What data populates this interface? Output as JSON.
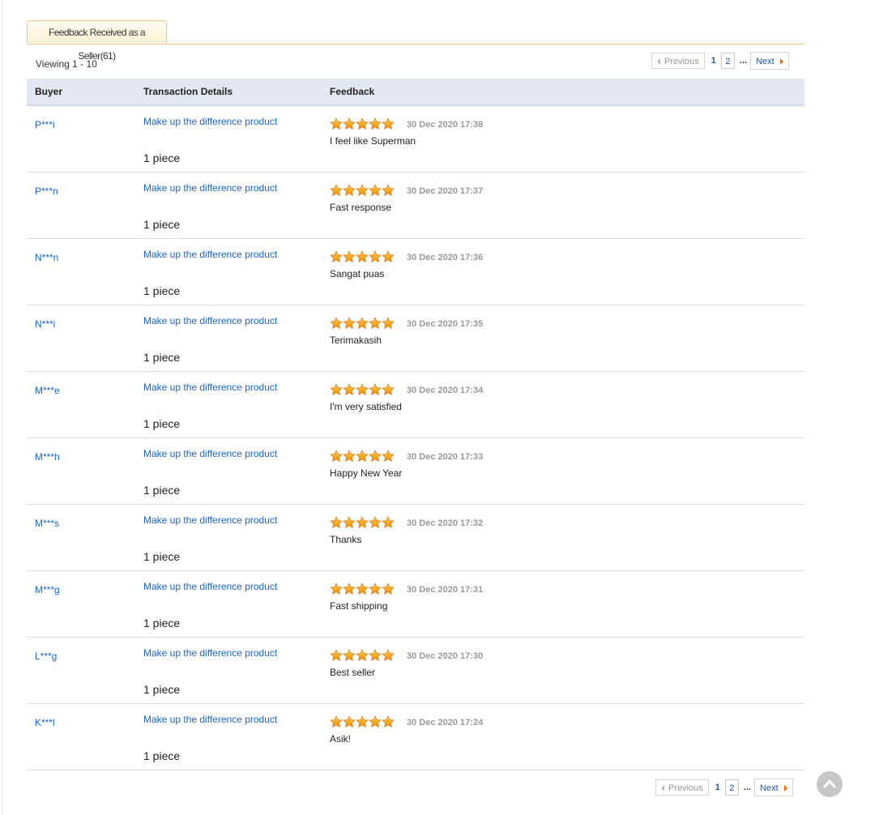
{
  "tab": {
    "label": "Feedback Received as a Seller(61)"
  },
  "viewing": "Viewing 1 - 10",
  "pager": {
    "prev": "Previous",
    "current": "1",
    "page2": "2",
    "dots": "...",
    "next": "Next"
  },
  "columns": {
    "buyer": "Buyer",
    "transaction": "Transaction Details",
    "feedback": "Feedback"
  },
  "rows": [
    {
      "buyer": "P***i",
      "product": "Make up the difference product",
      "qty": "1 piece",
      "date": "30 Dec 2020 17:38",
      "comment": "I feel like Superman",
      "stars": 5
    },
    {
      "buyer": "P***n",
      "product": "Make up the difference product",
      "qty": "1 piece",
      "date": "30 Dec 2020 17:37",
      "comment": "Fast response",
      "stars": 5
    },
    {
      "buyer": "N***n",
      "product": "Make up the difference product",
      "qty": "1 piece",
      "date": "30 Dec 2020 17:36",
      "comment": "Sangat puas",
      "stars": 5
    },
    {
      "buyer": "N***i",
      "product": "Make up the difference product",
      "qty": "1 piece",
      "date": "30 Dec 2020 17:35",
      "comment": "Terimakasih",
      "stars": 5
    },
    {
      "buyer": "M***e",
      "product": "Make up the difference product",
      "qty": "1 piece",
      "date": "30 Dec 2020 17:34",
      "comment": "I'm very satisfied",
      "stars": 5
    },
    {
      "buyer": "M***h",
      "product": "Make up the difference product",
      "qty": "1 piece",
      "date": "30 Dec 2020 17:33",
      "comment": "Happy New Year",
      "stars": 5
    },
    {
      "buyer": "M***s",
      "product": "Make up the difference product",
      "qty": "1 piece",
      "date": "30 Dec 2020 17:32",
      "comment": "Thanks",
      "stars": 5
    },
    {
      "buyer": "M***g",
      "product": "Make up the difference product",
      "qty": "1 piece",
      "date": "30 Dec 2020 17:31",
      "comment": "Fast shipping",
      "stars": 5
    },
    {
      "buyer": "L***g",
      "product": "Make up the difference product",
      "qty": "1 piece",
      "date": "30 Dec 2020 17:30",
      "comment": "Best seller",
      "stars": 5
    },
    {
      "buyer": "K***l",
      "product": "Make up the difference product",
      "qty": "1 piece",
      "date": "30 Dec 2020 17:24",
      "comment": "Asik!",
      "stars": 5
    }
  ],
  "icons": {
    "star": "star-icon",
    "back_to_top": "chevron-up-icon"
  },
  "colors": {
    "link": "#1a66c8",
    "star": "#f7941d",
    "tab_border": "#f0c57e",
    "header_bg": "#e2e7f1"
  }
}
